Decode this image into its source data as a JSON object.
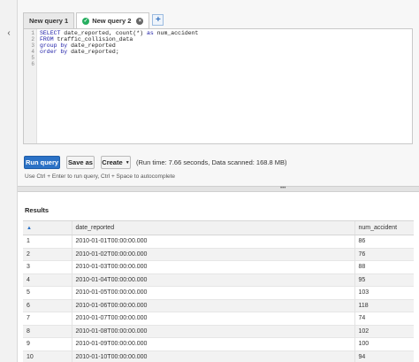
{
  "editor_tabs": [
    {
      "label": "New query 1",
      "active": false
    },
    {
      "label": "New query 2",
      "active": true
    }
  ],
  "tab_add_label": "+",
  "sql_lines": [
    [
      {
        "t": "SELECT",
        "kw": true
      },
      {
        "t": " date_reported, count(*) ",
        "kw": false
      },
      {
        "t": "as",
        "kw": true
      },
      {
        "t": " num_accident",
        "kw": false
      }
    ],
    [
      {
        "t": "FROM",
        "kw": true
      },
      {
        "t": " traffic_collision_data",
        "kw": false
      }
    ],
    [
      {
        "t": "group by",
        "kw": true
      },
      {
        "t": " date_reported",
        "kw": false
      }
    ],
    [
      {
        "t": "order by",
        "kw": true
      },
      {
        "t": " date_reported;",
        "kw": false
      }
    ],
    [],
    []
  ],
  "line_numbers": [
    "1",
    "2",
    "3",
    "4",
    "5",
    "6"
  ],
  "buttons": {
    "run": "Run query",
    "save": "Save as",
    "create": "Create"
  },
  "run_info": "(Run time: 7.66 seconds, Data scanned: 168.8 MB)",
  "hint": "Use Ctrl + Enter to run query, Ctrl + Space to autocomplete",
  "results": {
    "title": "Results",
    "columns": [
      "date_reported",
      "num_accident"
    ],
    "rows": [
      {
        "idx": "1",
        "date": "2010-01-01T00:00:00.000",
        "num": "86"
      },
      {
        "idx": "2",
        "date": "2010-01-02T00:00:00.000",
        "num": "76"
      },
      {
        "idx": "3",
        "date": "2010-01-03T00:00:00.000",
        "num": "88"
      },
      {
        "idx": "4",
        "date": "2010-01-04T00:00:00.000",
        "num": "95"
      },
      {
        "idx": "5",
        "date": "2010-01-05T00:00:00.000",
        "num": "103"
      },
      {
        "idx": "6",
        "date": "2010-01-06T00:00:00.000",
        "num": "118"
      },
      {
        "idx": "7",
        "date": "2010-01-07T00:00:00.000",
        "num": "74"
      },
      {
        "idx": "8",
        "date": "2010-01-08T00:00:00.000",
        "num": "102"
      },
      {
        "idx": "9",
        "date": "2010-01-09T00:00:00.000",
        "num": "100"
      },
      {
        "idx": "10",
        "date": "2010-01-10T00:00:00.000",
        "num": "94"
      }
    ]
  },
  "icons": {
    "collapse": "chevron-left-icon",
    "tab_ok": "check-circle-icon",
    "tab_close": "close-circle-icon",
    "create_caret": "caret-down-icon",
    "sort": "sort-icon",
    "splitter": "drag-handle-icon"
  },
  "colors": {
    "primary_button": "#2b72c6",
    "success": "#27ae60",
    "sql_keyword": "#1a1aa6"
  }
}
